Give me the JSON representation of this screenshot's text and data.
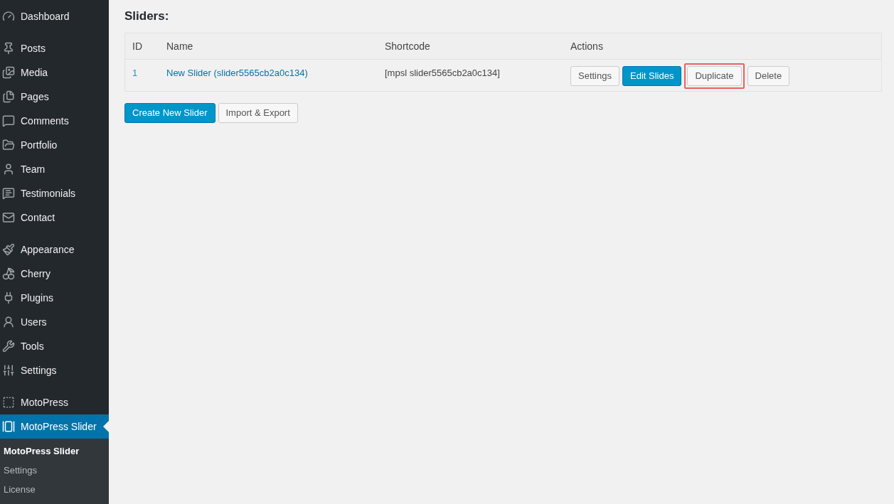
{
  "sidebar": {
    "groups": [
      {
        "items": [
          {
            "label": "Dashboard",
            "selected": false
          }
        ]
      },
      {
        "items": [
          {
            "label": "Posts",
            "selected": false
          },
          {
            "label": "Media",
            "selected": false
          },
          {
            "label": "Pages",
            "selected": false
          },
          {
            "label": "Comments",
            "selected": false
          },
          {
            "label": "Portfolio",
            "selected": false
          },
          {
            "label": "Team",
            "selected": false
          },
          {
            "label": "Testimonials",
            "selected": false
          },
          {
            "label": "Contact",
            "selected": false
          }
        ]
      },
      {
        "items": [
          {
            "label": "Appearance",
            "selected": false
          },
          {
            "label": "Cherry",
            "selected": false
          },
          {
            "label": "Plugins",
            "selected": false
          },
          {
            "label": "Users",
            "selected": false
          },
          {
            "label": "Tools",
            "selected": false
          },
          {
            "label": "Settings",
            "selected": false
          }
        ]
      },
      {
        "items": [
          {
            "label": "MotoPress",
            "selected": false
          },
          {
            "label": "MotoPress Slider",
            "selected": true
          }
        ]
      }
    ],
    "submenu": [
      {
        "label": "MotoPress Slider",
        "selected": true
      },
      {
        "label": "Settings",
        "selected": false
      },
      {
        "label": "License",
        "selected": false
      }
    ]
  },
  "page": {
    "title": "Sliders:",
    "table": {
      "columns": [
        "ID",
        "Name",
        "Shortcode",
        "Actions"
      ],
      "rows": [
        {
          "id": "1",
          "name": "New Slider (slider5565cb2a0c134)",
          "shortcode": "[mpsl slider5565cb2a0c134]",
          "actions": [
            {
              "label": "Settings",
              "kind": "secondary",
              "highlighted": false
            },
            {
              "label": "Edit Slides",
              "kind": "primary",
              "highlighted": false
            },
            {
              "label": "Duplicate",
              "kind": "secondary",
              "highlighted": true
            },
            {
              "label": "Delete",
              "kind": "secondary",
              "highlighted": false
            }
          ]
        }
      ]
    },
    "buttons": [
      {
        "label": "Create New Slider",
        "kind": "primary"
      },
      {
        "label": "Import & Export",
        "kind": "secondary"
      }
    ]
  }
}
